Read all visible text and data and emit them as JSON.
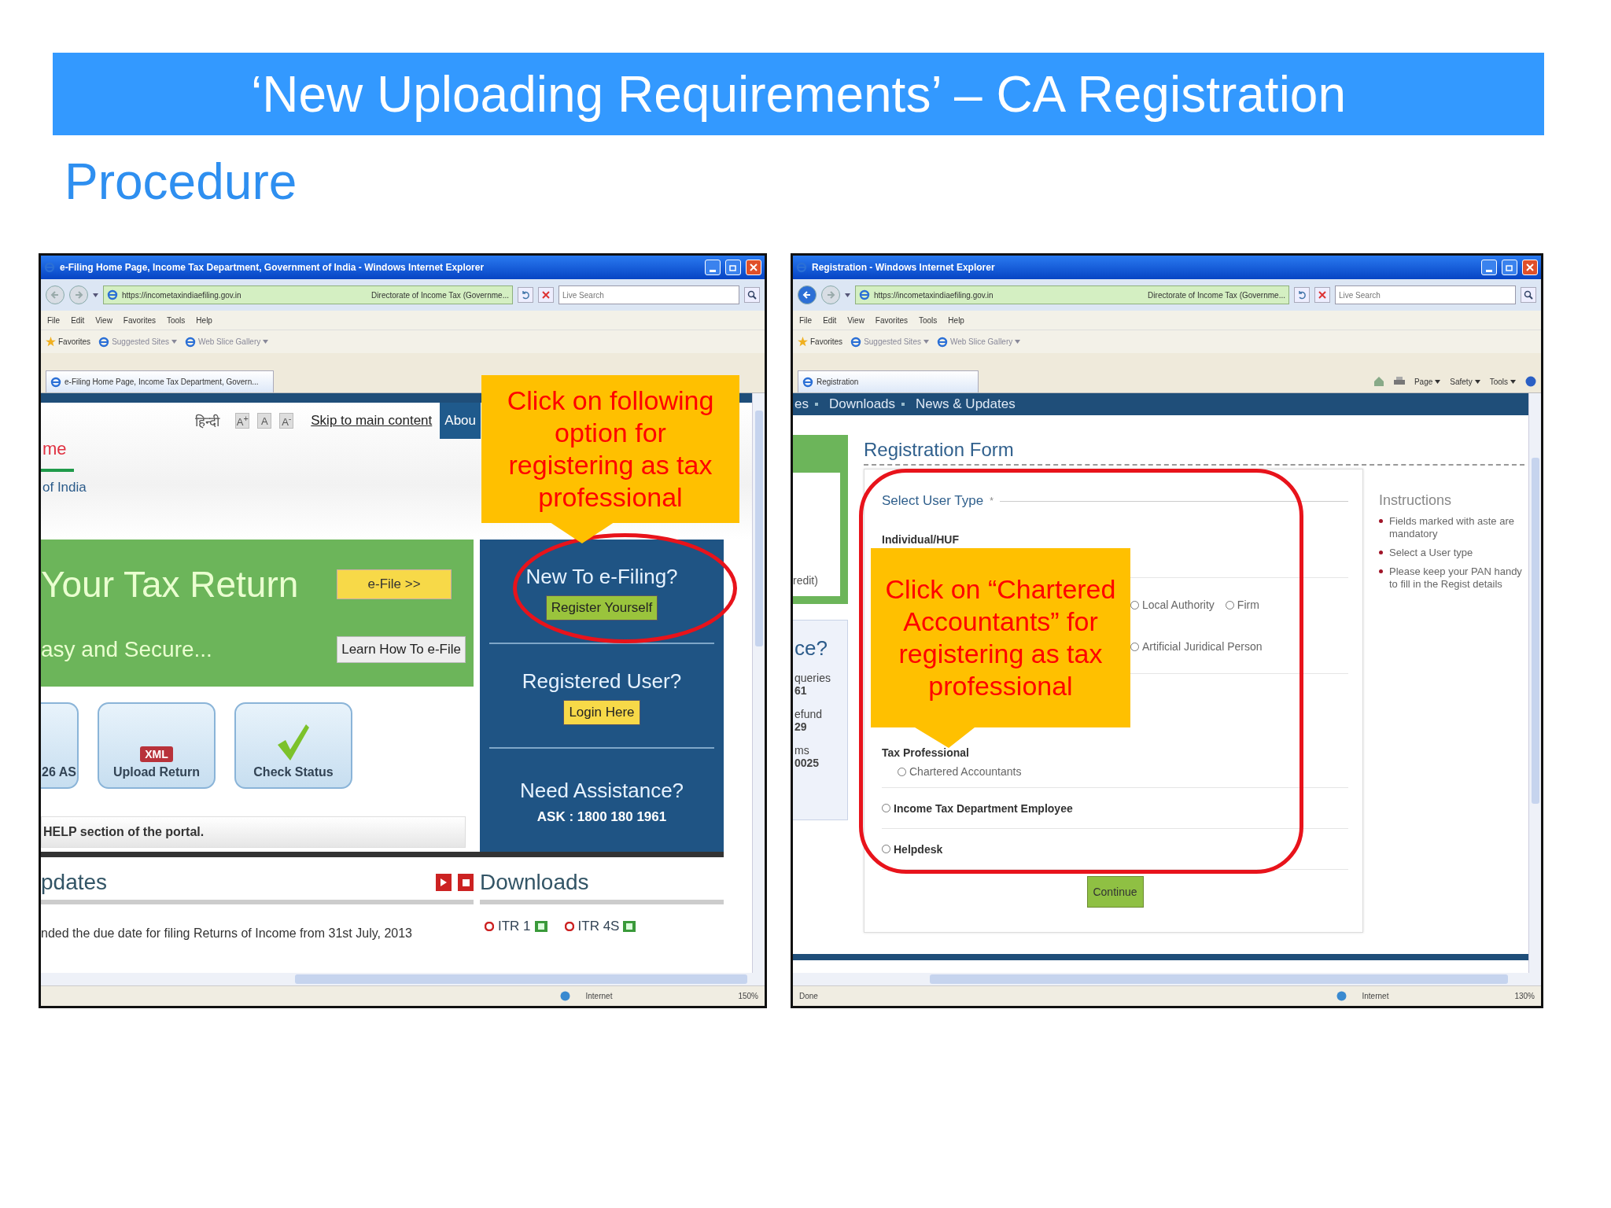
{
  "slide": {
    "title": "‘New Uploading Requirements’ – CA Registration",
    "subtitle": "Procedure"
  },
  "windows": [
    {
      "chrome": {
        "title": "e-Filing Home Page, Income Tax Department, Government of India - Windows Internet Explorer",
        "back_enabled": false,
        "url": "https://incometaxindiaefiling.gov.in",
        "site_label": "Directorate of Income Tax (Governme...",
        "search_placeholder": "Live Search",
        "menu": [
          "File",
          "Edit",
          "View",
          "Favorites",
          "Tools",
          "Help"
        ],
        "favorites_label": "Favorites",
        "favorites_links": [
          "Suggested Sites",
          "Web Slice Gallery"
        ],
        "tab_title": "e-Filing Home Page, Income Tax Department, Govern...",
        "zone": "Internet",
        "zoom": "150%"
      },
      "page": {
        "kind": "home",
        "header": {
          "language": "हिन्दी",
          "font_sizes": [
            "A$^{+}$",
            "A",
            "A$^{-}$"
          ],
          "skip_link": "Skip to main content",
          "nav_tab": "Abou",
          "brand_lines": [
            "me",
            "of India"
          ]
        },
        "banner": {
          "heading": "Your Tax Return",
          "subheading": "asy and Secure...",
          "efile_button": "e-File >>",
          "learn_button": "Learn How To e-File"
        },
        "tiles": [
          {
            "kind": "plain",
            "label": "26 AS"
          },
          {
            "kind": "xml",
            "label": "Upload Return",
            "badge": "XML"
          },
          {
            "kind": "check",
            "label": "Check Status"
          }
        ],
        "help_text": "HELP section of the portal.",
        "panel": [
          {
            "heading": "New To e-Filing?",
            "button": "Register Yourself",
            "kind": "green"
          },
          {
            "heading": "Registered User?",
            "button": "Login Here",
            "kind": "yellow"
          },
          {
            "heading": "Need Assistance?",
            "note": "ASK : 1800 180 1961",
            "kind": "info"
          }
        ],
        "updates": {
          "heading": "pdates",
          "news": "nded the due date for filing Returns of Income from 31st July, 2013"
        },
        "downloads": {
          "heading": "Downloads",
          "items": [
            "ITR 1",
            "ITR 4S"
          ]
        },
        "callout": "Click on following option for registering as tax professional"
      }
    },
    {
      "chrome": {
        "title": "Registration - Windows Internet Explorer",
        "back_enabled": true,
        "url": "https://incometaxindiaefiling.gov.in",
        "site_label": "Directorate of Income Tax (Governme...",
        "search_placeholder": "Live Search",
        "menu": [
          "File",
          "Edit",
          "View",
          "Favorites",
          "Tools",
          "Help"
        ],
        "favorites_label": "Favorites",
        "favorites_links": [
          "Suggested Sites",
          "Web Slice Gallery"
        ],
        "tab_title": "Registration",
        "command_bar": [
          "Page",
          "Safety",
          "Tools"
        ],
        "status_text": "Done",
        "zone": "Internet",
        "zoom": "130%"
      },
      "page": {
        "kind": "registration",
        "nav": [
          "es",
          "Downloads",
          "News & Updates"
        ],
        "side_note": "redit)",
        "side_lines": [
          {
            "kind": "heading",
            "text": "ce?"
          },
          {
            "kind": "label",
            "text": "queries"
          },
          {
            "kind": "value",
            "text": "61"
          },
          {
            "kind": "label",
            "text": "efund"
          },
          {
            "kind": "value",
            "text": "29"
          },
          {
            "kind": "label",
            "text": "ms"
          },
          {
            "kind": "value",
            "text": "0025"
          }
        ],
        "form_title": "Registration Form",
        "legend": "Select User Type",
        "required_mark": "*",
        "rows": [
          {
            "kind": "group",
            "label": "Individual/HUF",
            "options": []
          },
          {
            "kind": "radios",
            "options": [
              {
                "label": "Local Authority",
                "selected": false
              },
              {
                "label": "Firm",
                "selected": false
              }
            ]
          },
          {
            "kind": "radios",
            "options": [
              {
                "label": "Artificial Juridical Person",
                "selected": false
              }
            ]
          },
          {
            "kind": "group",
            "label": "Tax Professional",
            "options": [
              {
                "label": "Chartered Accountants",
                "selected": false
              }
            ]
          },
          {
            "kind": "main",
            "options": [
              {
                "label": "Income Tax Department Employee",
                "selected": false
              }
            ]
          },
          {
            "kind": "main",
            "options": [
              {
                "label": "Helpdesk",
                "selected": false
              }
            ]
          }
        ],
        "button": "Continue",
        "instructions": {
          "title": "Instructions",
          "items": [
            "Fields marked with aste are mandatory",
            "Select a User type",
            "Please keep your PAN handy to fill in the Regist details"
          ]
        },
        "callout": "Click on “Chartered Accountants” for registering as tax professional"
      }
    }
  ]
}
